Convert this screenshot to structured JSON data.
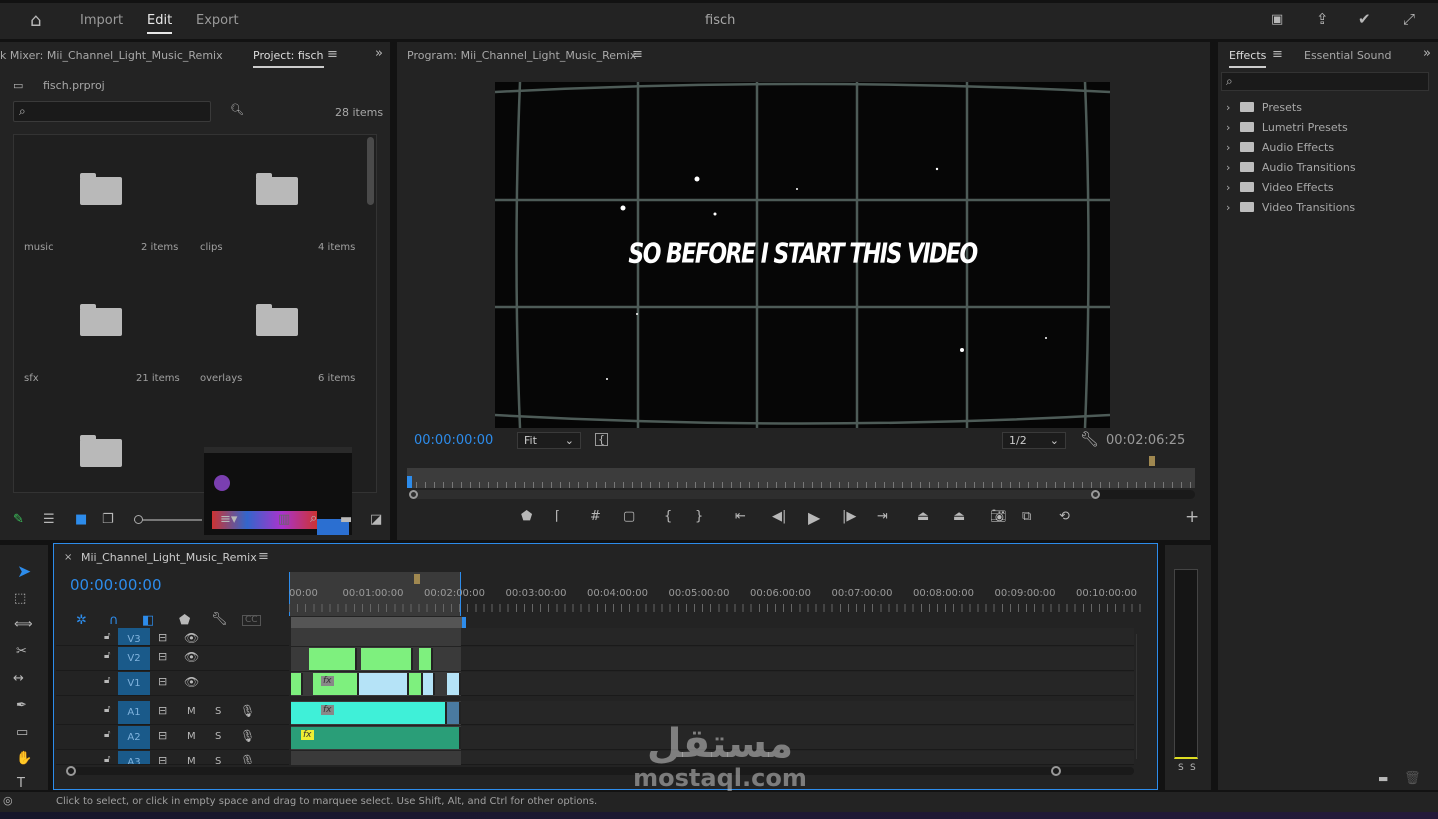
{
  "topbar": {
    "nav": [
      "Import",
      "Edit",
      "Export"
    ],
    "active": "Edit",
    "title": "fisch"
  },
  "project": {
    "tab_mixer": "k Mixer: Mii_Channel_Light_Music_Remix",
    "tab_project": "Project: fisch",
    "project_file": "fisch.prproj",
    "search_placeholder": "",
    "item_count": "28 items",
    "bins": [
      {
        "name": "music",
        "count": "2 items"
      },
      {
        "name": "clips",
        "count": "4 items"
      },
      {
        "name": "sfx",
        "count": "21 items"
      },
      {
        "name": "overlays",
        "count": "6 items"
      },
      {
        "name": "",
        "count": ""
      }
    ]
  },
  "program": {
    "title": "Program: Mii_Channel_Light_Music_Remix",
    "caption": "SO BEFORE I START THIS VIDEO",
    "timecode": "00:00:00:00",
    "zoom": "Fit",
    "resolution": "1/2",
    "duration": "00:02:06:25"
  },
  "effects": {
    "tab_effects": "Effects",
    "tab_sound": "Essential Sound",
    "items": [
      "Presets",
      "Lumetri Presets",
      "Audio Effects",
      "Audio Transitions",
      "Video Effects",
      "Video Transitions"
    ]
  },
  "timeline": {
    "sequence": "Mii_Channel_Light_Music_Remix",
    "timecode": "00:00:00:00",
    "ruler": [
      "00:00",
      "00:01:00:00",
      "00:02:00:00",
      "00:03:00:00",
      "00:04:00:00",
      "00:05:00:00",
      "00:06:00:00",
      "00:07:00:00",
      "00:08:00:00",
      "00:09:00:00",
      "00:10:00:00"
    ],
    "video_tracks": [
      "V3",
      "V2",
      "V1"
    ],
    "audio_tracks": [
      "A1",
      "A2",
      "A3"
    ],
    "mute": "M",
    "solo": "S",
    "fx": "fx",
    "cc": "CC"
  },
  "meter": {
    "solo_left": "S",
    "solo_right": "S"
  },
  "status": "Click to select, or click in empty space and drag to marquee select. Use Shift, Alt, and Ctrl for other options.",
  "watermark": {
    "arabic": "مستقل",
    "latin": "mostaql.com"
  },
  "colors": {
    "accent": "#2d8ceb",
    "v_clip": "#7ef07e",
    "v_clip_alt": "#b5e3f7",
    "audio": "#3ff0d8",
    "track_label": "#1a5a8a"
  }
}
